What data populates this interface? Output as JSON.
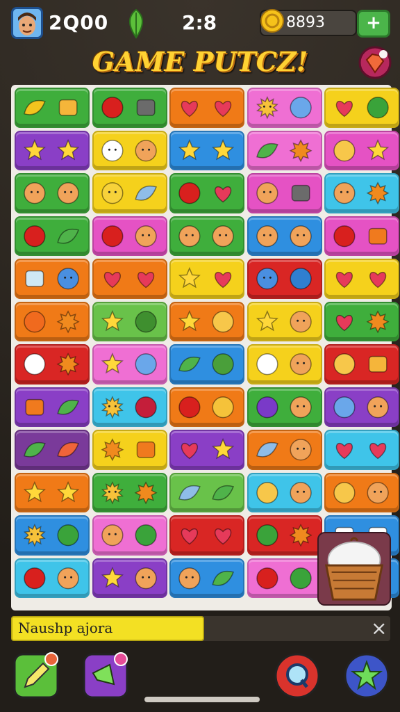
{
  "hud": {
    "score": "2Q00",
    "timer": "2:8",
    "coins": "8893",
    "plus_label": "+"
  },
  "title": "GAME PUTCZ!",
  "message": "Naushp ajora",
  "close_label": "×",
  "colors": {
    "green": "#3fae3c",
    "purple": "#8a3fc6",
    "orange": "#f07a17",
    "pink": "#ef6fd3",
    "yellow": "#f5d11c",
    "blue": "#2f8fe0",
    "red": "#d92624",
    "cyan": "#3fc4e9",
    "magenta": "#e552c4",
    "lime": "#69c24a",
    "darkpurple": "#7a3a9a"
  },
  "board": {
    "rows": [
      [
        [
          "green",
          "banana",
          "pie"
        ],
        [
          "green",
          "apple",
          "pot"
        ],
        [
          "orange",
          "heart",
          "heart"
        ],
        [
          "pink",
          "sun",
          "ball"
        ],
        [
          "yellow",
          "heart",
          "bush"
        ]
      ],
      [
        [
          "purple",
          "star",
          "star"
        ],
        [
          "yellow",
          "ghost",
          "face"
        ],
        [
          "blue",
          "star",
          "star"
        ],
        [
          "pink",
          "leaf",
          "flower"
        ],
        [
          "magenta",
          "hand",
          "star"
        ]
      ],
      [
        [
          "green",
          "face",
          "face"
        ],
        [
          "yellow",
          "bird",
          "shell"
        ],
        [
          "green",
          "apple",
          "heart"
        ],
        [
          "magenta",
          "face",
          "pot"
        ],
        [
          "cyan",
          "face",
          "flower"
        ]
      ],
      [
        [
          "green",
          "apple",
          "leaf"
        ],
        [
          "magenta",
          "apple",
          "face"
        ],
        [
          "green",
          "face",
          "face"
        ],
        [
          "blue",
          "face",
          "face"
        ],
        [
          "magenta",
          "apple",
          "box"
        ]
      ],
      [
        [
          "orange",
          "cup",
          "cat"
        ],
        [
          "orange",
          "heart",
          "heart"
        ],
        [
          "yellow",
          "star",
          "heart"
        ],
        [
          "red",
          "cat",
          "disk"
        ],
        [
          "yellow",
          "heart",
          "heart"
        ]
      ],
      [
        [
          "orange",
          "fruit",
          "flower"
        ],
        [
          "lime",
          "star",
          "palm"
        ],
        [
          "orange",
          "star",
          "hand"
        ],
        [
          "yellow",
          "star",
          "face"
        ],
        [
          "green",
          "heart",
          "flower"
        ]
      ],
      [
        [
          "red",
          "tree",
          "flower"
        ],
        [
          "pink",
          "star",
          "ball"
        ],
        [
          "blue",
          "leaf",
          "brush"
        ],
        [
          "yellow",
          "tree",
          "face"
        ],
        [
          "red",
          "hand",
          "pie"
        ]
      ],
      [
        [
          "purple",
          "box",
          "leaf"
        ],
        [
          "cyan",
          "sun",
          "berry"
        ],
        [
          "orange",
          "apple",
          "swirl"
        ],
        [
          "green",
          "bean",
          "face"
        ],
        [
          "purple",
          "ball",
          "face"
        ]
      ],
      [
        [
          "darkpurple",
          "leaf",
          "cone"
        ],
        [
          "yellow",
          "flower",
          "box"
        ],
        [
          "purple",
          "heart",
          "star"
        ],
        [
          "orange",
          "shell",
          "face"
        ],
        [
          "cyan",
          "heart",
          "heart"
        ]
      ],
      [
        [
          "orange",
          "star",
          "star"
        ],
        [
          "green",
          "sun",
          "flower"
        ],
        [
          "lime",
          "shell",
          "leaf"
        ],
        [
          "cyan",
          "hand",
          "face"
        ],
        [
          "orange",
          "hand",
          "face"
        ]
      ],
      [
        [
          "blue",
          "sun",
          "bush"
        ],
        [
          "pink",
          "face",
          "bush"
        ],
        [
          "red",
          "heart",
          "heart"
        ],
        [
          "red",
          "bush",
          "flower"
        ],
        [
          "blue",
          "cake",
          "cake"
        ]
      ],
      [
        [
          "cyan",
          "apple",
          "face"
        ],
        [
          "purple",
          "star",
          "face"
        ],
        [
          "blue",
          "face",
          "leaf"
        ],
        [
          "pink",
          "apple",
          "bush"
        ],
        [
          "blue",
          "cake",
          "cake"
        ]
      ]
    ]
  },
  "bottom_buttons": [
    {
      "name": "pencil-tool-button",
      "color": "#5bbf3a",
      "icon": "pencil-icon",
      "badge": "#e8643a"
    },
    {
      "name": "megaphone-button",
      "color": "#8a3fc6",
      "icon": "megaphone-icon",
      "badge": "#e64c97"
    },
    {
      "name": "search-hint-button",
      "color": "#d9332c",
      "icon": "magnifier-icon",
      "badge": ""
    },
    {
      "name": "star-bonus-button",
      "color": "#3d55c8",
      "icon": "star-icon",
      "badge": ""
    }
  ]
}
